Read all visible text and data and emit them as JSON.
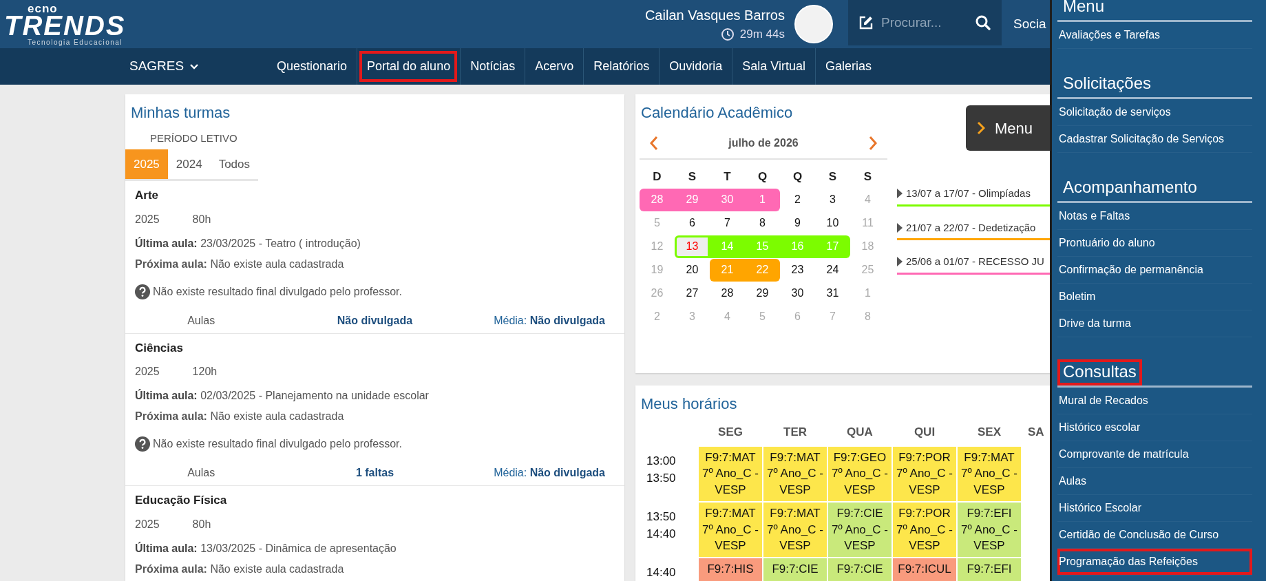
{
  "header": {
    "logo": {
      "small": "ecno",
      "big": "TRENDS",
      "tagline": "Tecnologia Educacional"
    },
    "user": {
      "name": "Cailan Vasques Barros",
      "timer": "29m 44s"
    },
    "search": {
      "placeholder": "Procurar..."
    },
    "social": "Socia"
  },
  "nav": {
    "brand": "SAGRES",
    "items": [
      {
        "label": "Questionario",
        "highlighted": false
      },
      {
        "label": "Portal do aluno",
        "highlighted": true
      },
      {
        "label": "Notícias",
        "highlighted": false
      },
      {
        "label": "Acervo",
        "highlighted": false
      },
      {
        "label": "Relatórios",
        "highlighted": false
      },
      {
        "label": "Ouvidoria",
        "highlighted": false
      },
      {
        "label": "Sala Virtual",
        "highlighted": false
      },
      {
        "label": "Galerias",
        "highlighted": false
      }
    ]
  },
  "turmas": {
    "title": "Minhas turmas",
    "period_label": "PERÍODO LETIVO",
    "tabs": [
      {
        "label": "2025",
        "selected": true
      },
      {
        "label": "2024",
        "selected": false
      },
      {
        "label": "Todos",
        "selected": false
      }
    ],
    "courses": [
      {
        "name": "Arte",
        "year": "2025",
        "hours": "80h",
        "last": "**Última aula:** 23/03/2025 - Teatro ( introdução)",
        "next": "**Próxima aula:** Não existe aula cadastrada",
        "note": "Não existe resultado final divulgado pelo professor.",
        "footer": {
          "link": "Aulas",
          "faltas": "Não divulgada",
          "media": "Média: **Não divulgada**"
        }
      },
      {
        "name": "Ciências",
        "year": "2025",
        "hours": "120h",
        "last": "**Última aula:** 02/03/2025 - Planejamento na unidade escolar",
        "next": "**Próxima aula:** Não existe aula cadastrada",
        "note": "Não existe resultado final divulgado pelo professor.",
        "footer": {
          "link": "Aulas",
          "faltas": "1 faltas",
          "media": "Média: **Não divulgada**"
        }
      },
      {
        "name": "Educação Física",
        "year": "2025",
        "hours": "80h",
        "last": "**Última aula:** 13/03/2025 - Dinâmica de apresentação",
        "next": "**Próxima aula:** Não existe aula cadastrada"
      }
    ]
  },
  "calendar": {
    "title": "Calendário Acadêmico",
    "month": "julho de 2026",
    "weekdays": [
      "D",
      "S",
      "T",
      "Q",
      "Q",
      "S",
      "S"
    ],
    "days": [
      {
        "day": "28",
        "muted": false,
        "today": false,
        "color": "#ff69b4"
      },
      {
        "day": "29",
        "muted": false,
        "today": false,
        "color": "#ff69b4"
      },
      {
        "day": "30",
        "muted": false,
        "today": false,
        "color": "#ff69b4"
      },
      {
        "day": "1",
        "muted": false,
        "today": false,
        "color": "#ff69b4"
      },
      {
        "day": "2",
        "muted": false,
        "today": false
      },
      {
        "day": "3",
        "muted": false,
        "today": false
      },
      {
        "day": "4",
        "muted": true,
        "today": false
      },
      {
        "day": "5",
        "muted": true,
        "today": false
      },
      {
        "day": "6",
        "muted": false,
        "today": false
      },
      {
        "day": "7",
        "muted": false,
        "today": false
      },
      {
        "day": "8",
        "muted": false,
        "today": false
      },
      {
        "day": "9",
        "muted": false,
        "today": false
      },
      {
        "day": "10",
        "muted": false,
        "today": false
      },
      {
        "day": "11",
        "muted": true,
        "today": false
      },
      {
        "day": "12",
        "muted": true,
        "today": false
      },
      {
        "day": "13",
        "muted": false,
        "today": true,
        "color": "#7cfc00"
      },
      {
        "day": "14",
        "muted": false,
        "today": false,
        "color": "#7cfc00"
      },
      {
        "day": "15",
        "muted": false,
        "today": false,
        "color": "#7cfc00"
      },
      {
        "day": "16",
        "muted": false,
        "today": false,
        "color": "#7cfc00"
      },
      {
        "day": "17",
        "muted": false,
        "today": false,
        "color": "#7cfc00"
      },
      {
        "day": "18",
        "muted": true,
        "today": false
      },
      {
        "day": "19",
        "muted": true,
        "today": false
      },
      {
        "day": "20",
        "muted": false,
        "today": false
      },
      {
        "day": "21",
        "muted": false,
        "today": false,
        "color": "#ffa500"
      },
      {
        "day": "22",
        "muted": false,
        "today": false,
        "color": "#ffa500"
      },
      {
        "day": "23",
        "muted": false,
        "today": false
      },
      {
        "day": "24",
        "muted": false,
        "today": false
      },
      {
        "day": "25",
        "muted": true,
        "today": false
      },
      {
        "day": "26",
        "muted": true,
        "today": false
      },
      {
        "day": "27",
        "muted": false,
        "today": false
      },
      {
        "day": "28",
        "muted": false,
        "today": false
      },
      {
        "day": "29",
        "muted": false,
        "today": false
      },
      {
        "day": "30",
        "muted": false,
        "today": false
      },
      {
        "day": "31",
        "muted": false,
        "today": false
      },
      {
        "day": "1",
        "muted": true,
        "today": false
      },
      {
        "day": "2",
        "muted": true,
        "today": false
      },
      {
        "day": "3",
        "muted": true,
        "today": false
      },
      {
        "day": "4",
        "muted": true,
        "today": false
      },
      {
        "day": "5",
        "muted": true,
        "today": false
      },
      {
        "day": "6",
        "muted": true,
        "today": false
      },
      {
        "day": "7",
        "muted": true,
        "today": false
      },
      {
        "day": "8",
        "muted": true,
        "today": false
      }
    ],
    "events": [
      {
        "text": "13/07 a 17/07 - Olimpíadas",
        "color": "#7cfc00"
      },
      {
        "text": "21/07 a 22/07 - Dedetização",
        "color": "#ffa500"
      },
      {
        "text": "25/06 a 01/07 - RECESSO JU",
        "color": "#ff69b4"
      }
    ]
  },
  "schedule": {
    "title": "Meus horários",
    "days": [
      "SEG",
      "TER",
      "QUA",
      "QUI",
      "SEX",
      "SA"
    ],
    "rows": [
      {
        "times": [
          "13:00",
          "13:50"
        ],
        "cells": [
          {
            "lines": [
              "F9:7:MAT",
              "7º Ano_C -",
              "VESP"
            ],
            "color": "#fde64b"
          },
          {
            "lines": [
              "F9:7:MAT",
              "7º Ano_C -",
              "VESP"
            ],
            "color": "#fde64b"
          },
          {
            "lines": [
              "F9:7:GEO",
              "7º Ano_C -",
              "VESP"
            ],
            "color": "#fde64b"
          },
          {
            "lines": [
              "F9:7:POR",
              "7º Ano_C -",
              "VESP"
            ],
            "color": "#fde64b"
          },
          {
            "lines": [
              "F9:7:MAT",
              "7º Ano_C -",
              "VESP"
            ],
            "color": "#fde64b"
          }
        ]
      },
      {
        "times": [
          "13:50",
          "14:40"
        ],
        "cells": [
          {
            "lines": [
              "F9:7:MAT",
              "7º Ano_C -",
              "VESP"
            ],
            "color": "#fde64b"
          },
          {
            "lines": [
              "F9:7:MAT",
              "7º Ano_C -",
              "VESP"
            ],
            "color": "#fde64b"
          },
          {
            "lines": [
              "F9:7:CIE",
              "7º Ano_C -",
              "VESP"
            ],
            "color": "#c9e97b"
          },
          {
            "lines": [
              "F9:7:POR",
              "7º Ano_C -",
              "VESP"
            ],
            "color": "#fde64b"
          },
          {
            "lines": [
              "F9:7:EFI",
              "7º Ano_C -",
              "VESP"
            ],
            "color": "#c9e97b"
          }
        ]
      },
      {
        "times": [
          "14:40"
        ],
        "cells": [
          {
            "lines": [
              "F9:7:HIS"
            ],
            "color": "#f99b7d"
          },
          {
            "lines": [
              "F9:7:CIE"
            ],
            "color": "#c9e97b"
          },
          {
            "lines": [
              "F9:7:CIE"
            ],
            "color": "#c9e97b"
          },
          {
            "lines": [
              "F9:7:ICUL"
            ],
            "color": "#f99b7d"
          },
          {
            "lines": [
              "F9:7:EFI"
            ],
            "color": "#c9e97b"
          }
        ]
      }
    ]
  },
  "menu_button": {
    "label": "Menu"
  },
  "side_menu": {
    "sections": [
      {
        "title": "Menu",
        "highlighted": false,
        "items": [
          {
            "label": "Avaliações e Tarefas",
            "highlighted": false
          }
        ]
      },
      {
        "title": "Solicitações",
        "highlighted": false,
        "items": [
          {
            "label": "Solicitação de serviços",
            "highlighted": false
          },
          {
            "label": "Cadastrar Solicitação de Serviços",
            "highlighted": false
          }
        ]
      },
      {
        "title": "Acompanhamento",
        "highlighted": false,
        "items": [
          {
            "label": "Notas e Faltas",
            "highlighted": false
          },
          {
            "label": "Prontuário do aluno",
            "highlighted": false
          },
          {
            "label": "Confirmação de permanência",
            "highlighted": false
          },
          {
            "label": "Boletim",
            "highlighted": false
          },
          {
            "label": "Drive da turma",
            "highlighted": false
          }
        ]
      },
      {
        "title": "Consultas",
        "highlighted": true,
        "items": [
          {
            "label": "Mural de Recados",
            "highlighted": false
          },
          {
            "label": "Histórico escolar",
            "highlighted": false
          },
          {
            "label": "Comprovante de matrícula",
            "highlighted": false
          },
          {
            "label": "Aulas",
            "highlighted": false
          },
          {
            "label": "Histórico Escolar",
            "highlighted": false
          },
          {
            "label": "Certidão de Conclusão de Curso",
            "highlighted": false
          },
          {
            "label": "Programação das Refeições",
            "highlighted": true
          }
        ]
      }
    ]
  }
}
